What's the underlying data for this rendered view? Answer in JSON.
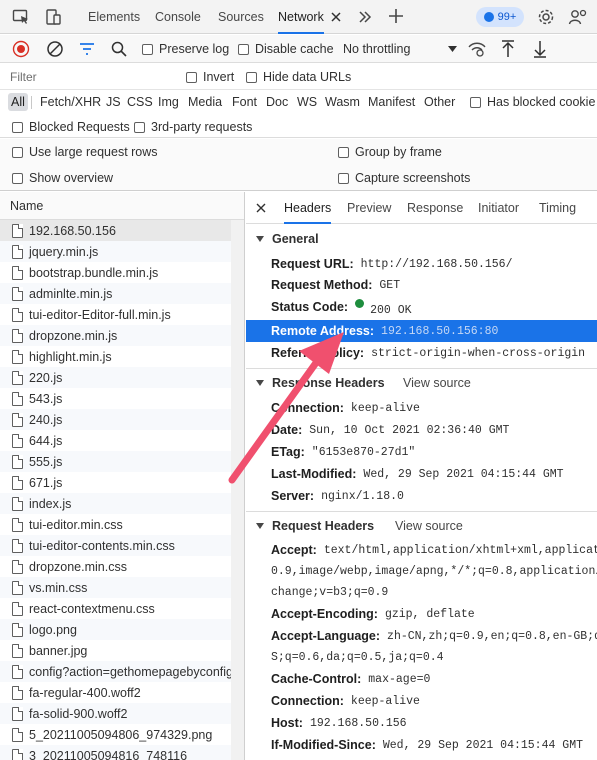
{
  "devtools": {
    "tabs": [
      "Elements",
      "Console",
      "Sources",
      "Network"
    ],
    "active_tab": "Network",
    "issues_badge": "99+"
  },
  "toolbar": {
    "preserve_log": "Preserve log",
    "disable_cache": "Disable cache",
    "throttling": "No throttling"
  },
  "filter": {
    "placeholder": "Filter",
    "invert": "Invert",
    "hide_data_urls": "Hide data URLs"
  },
  "types": [
    "All",
    "Fetch/XHR",
    "JS",
    "CSS",
    "Img",
    "Media",
    "Font",
    "Doc",
    "WS",
    "Wasm",
    "Manifest",
    "Other"
  ],
  "has_blocked_cookies": "Has blocked cookie",
  "blocked_requests": "Blocked Requests",
  "third_party": "3rd-party requests",
  "options": {
    "large_rows": "Use large request rows",
    "group_by_frame": "Group by frame",
    "show_overview": "Show overview",
    "capture_screenshots": "Capture screenshots"
  },
  "request_list": {
    "column": "Name",
    "items": [
      "192.168.50.156",
      "jquery.min.js",
      "bootstrap.bundle.min.js",
      "adminlte.min.js",
      "tui-editor-Editor-full.min.js",
      "dropzone.min.js",
      "highlight.min.js",
      "220.js",
      "543.js",
      "240.js",
      "644.js",
      "555.js",
      "671.js",
      "index.js",
      "tui-editor.min.css",
      "tui-editor-contents.min.css",
      "dropzone.min.css",
      "vs.min.css",
      "react-contextmenu.css",
      "logo.png",
      "banner.jpg",
      "config?action=gethomepagebyconfig",
      "fa-regular-400.woff2",
      "fa-solid-900.woff2",
      "5_20211005094806_974329.png",
      "3_20211005094816_748116"
    ]
  },
  "detail": {
    "tabs": [
      "Headers",
      "Preview",
      "Response",
      "Initiator",
      "Timing"
    ],
    "active_tab": "Headers",
    "general": {
      "title": "General",
      "request_url_k": "Request URL:",
      "request_url_v": "http://192.168.50.156/",
      "method_k": "Request Method:",
      "method_v": "GET",
      "status_k": "Status Code:",
      "status_v": "200 OK",
      "remote_k": "Remote Address:",
      "remote_v": "192.168.50.156:80",
      "referrer_k": "Referrer Policy:",
      "referrer_v": "strict-origin-when-cross-origin"
    },
    "response_headers": {
      "title": "Response Headers",
      "view_source": "View source",
      "connection_k": "Connection:",
      "connection_v": "keep-alive",
      "date_k": "Date:",
      "date_v": "Sun, 10 Oct 2021 02:36:40 GMT",
      "etag_k": "ETag:",
      "etag_v": "\"6153e870-27d1\"",
      "lastmod_k": "Last-Modified:",
      "lastmod_v": "Wed, 29 Sep 2021 04:15:44 GMT",
      "server_k": "Server:",
      "server_v": "nginx/1.18.0"
    },
    "request_headers": {
      "title": "Request Headers",
      "view_source": "View source",
      "accept_k": "Accept:",
      "accept_v": "text/html,application/xhtml+xml,applicati",
      "accept_v2": "0.9,image/webp,image/apng,*/*;q=0.8,application/",
      "accept_v3": "change;v=b3;q=0.9",
      "enc_k": "Accept-Encoding:",
      "enc_v": "gzip, deflate",
      "lang_k": "Accept-Language:",
      "lang_v": "zh-CN,zh;q=0.9,en;q=0.8,en-GB;q=",
      "lang_v2": "S;q=0.6,da;q=0.5,ja;q=0.4",
      "cache_k": "Cache-Control:",
      "cache_v": "max-age=0",
      "conn_k": "Connection:",
      "conn_v": "keep-alive",
      "host_k": "Host:",
      "host_v": "192.168.50.156",
      "ims_k": "If-Modified-Since:",
      "ims_v": "Wed, 29 Sep 2021 04:15:44 GMT"
    }
  },
  "colors": {
    "accent": "#1a73e8",
    "arrow": "#f0506e",
    "record": "#d93025"
  }
}
